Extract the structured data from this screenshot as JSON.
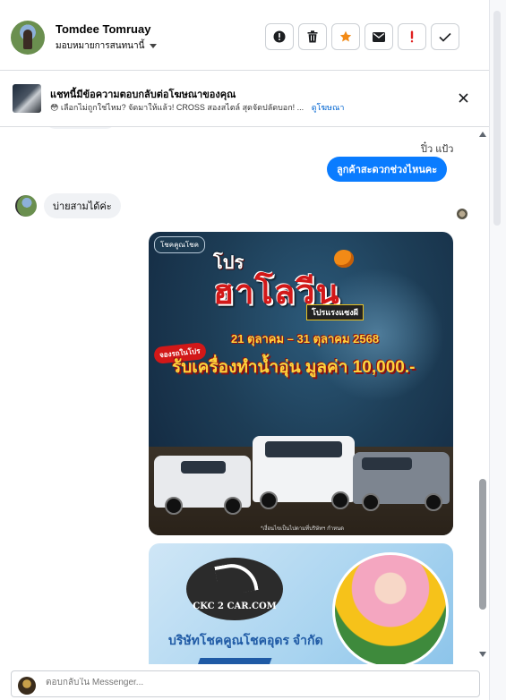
{
  "header": {
    "name": "Tomdee Tomruay",
    "assign_label": "มอบหมายการสนทนานี้",
    "actions": [
      {
        "icon": "spam-icon"
      },
      {
        "icon": "trash-icon"
      },
      {
        "icon": "star-icon",
        "color": "#f28a16"
      },
      {
        "icon": "mail-icon"
      },
      {
        "icon": "exclamation-icon",
        "color": "#e02020"
      },
      {
        "icon": "check-icon"
      }
    ]
  },
  "ad_banner": {
    "title": "แชทนี้มีข้อความตอบกลับต่อโฆษณาของคุณ",
    "text": "😳 เลือกไม่ถูกใช่ไหม? จัดมาให้แล้ว! CROSS สองสไตล์ สุดจัดปลัดบอก! ...",
    "link": "ดูโฆษณา"
  },
  "conversation": {
    "seen_name": "ปิ๋ว แป้ว",
    "outgoing_message": "ลูกค้าสะดวกช่วงไหนคะ",
    "incoming_message": "บ่ายสามได้ค่ะ",
    "accent_color": "#0a7cff"
  },
  "promo_image": {
    "logo": "โชคคูณโชค",
    "title_top": "โปร",
    "title_main": "ฮาโลวีน",
    "badge": "โปรแรงแซงผี",
    "dates": "21 ตุลาคม – 31 ตุลาคม 2568",
    "tag": "จองรถในโปร",
    "gift": "รับเครื่องทำน้ำอุ่น มูลค่า 10,000.-",
    "credit": "*เงื่อนไขเป็นไปตามที่บริษัทฯ กำหนด"
  },
  "promo_image_2": {
    "logo_text": "CKC 2 CAR.COM",
    "company": "บริษัทโชคคูณโชคอุดร จำกัด"
  },
  "composer": {
    "placeholder": "ตอบกลับใน Messenger..."
  }
}
